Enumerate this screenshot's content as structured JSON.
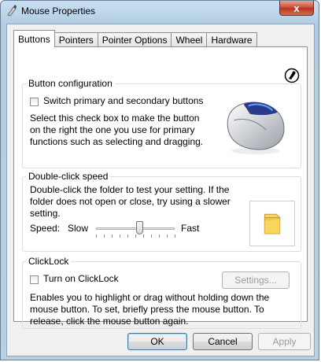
{
  "window": {
    "title": "Mouse Properties",
    "close_glyph": "x"
  },
  "tabs": [
    {
      "label": "Buttons",
      "active": true
    },
    {
      "label": "Pointers",
      "active": false
    },
    {
      "label": "Pointer Options",
      "active": false
    },
    {
      "label": "Wheel",
      "active": false
    },
    {
      "label": "Hardware",
      "active": false
    }
  ],
  "button_config": {
    "title": "Button configuration",
    "checkbox_label": "Switch primary and secondary buttons",
    "checked": false,
    "description": "Select this check box to make the button on the right the one you use for primary functions such as selecting and dragging.",
    "image_icon": "mouse-icon"
  },
  "double_click": {
    "title": "Double-click speed",
    "description": "Double-click the folder to test your setting. If the folder does not open or close, try using a slower setting.",
    "speed_label": "Speed:",
    "slow_label": "Slow",
    "fast_label": "Fast",
    "slider_level": 0.55,
    "test_icon": "folder-icon"
  },
  "clicklock": {
    "title": "ClickLock",
    "checkbox_label": "Turn on ClickLock",
    "checked": false,
    "settings_label": "Settings...",
    "description": "Enables you to highlight or drag without holding down the mouse button. To set, briefly press the mouse button. To release, click the mouse button again."
  },
  "footer": {
    "ok": "OK",
    "cancel": "Cancel",
    "apply": "Apply"
  },
  "colors": {
    "title_bar": "#b9d1e6",
    "close_button": "#c74a35",
    "folder": "#f0c24a"
  }
}
